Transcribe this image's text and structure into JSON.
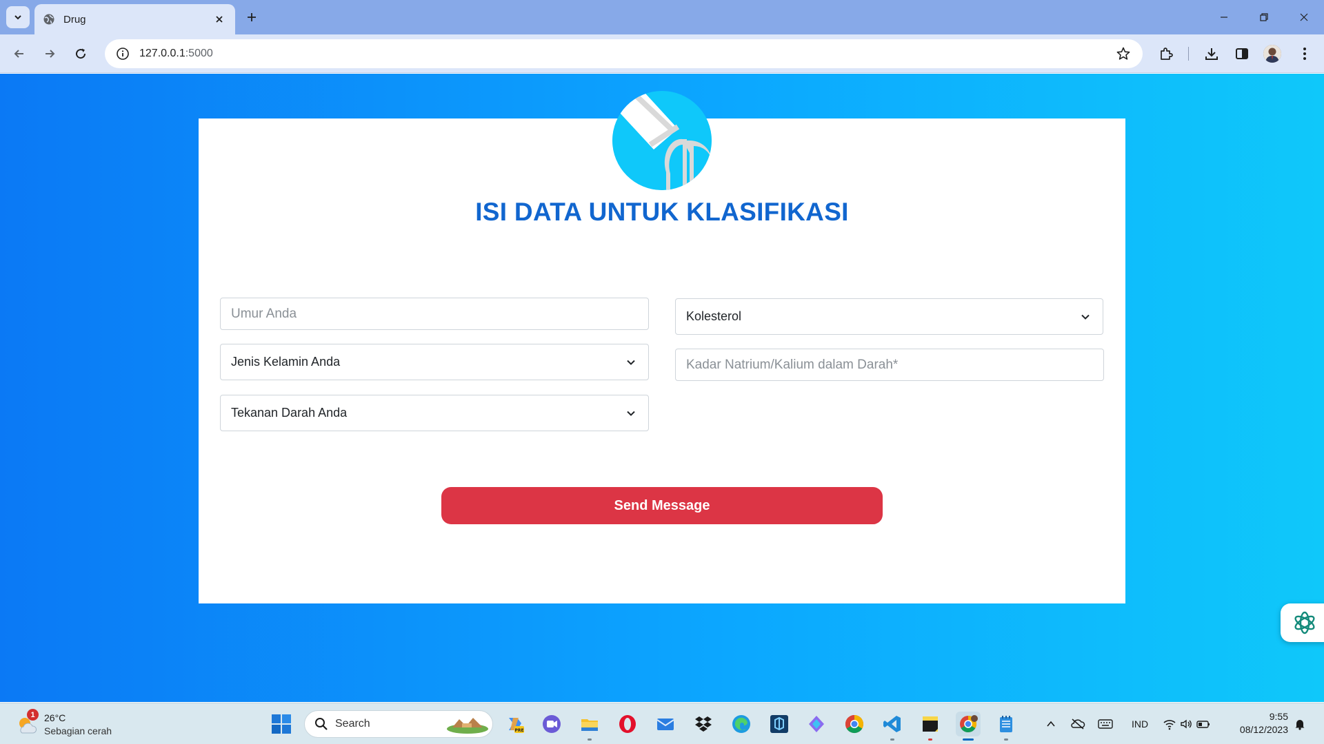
{
  "browser": {
    "tab_title": "Drug",
    "url_host": "127.0.0.1",
    "url_port": ":5000"
  },
  "form": {
    "title": "ISI DATA UNTUK KLASIFIKASI",
    "age_placeholder": "Umur Anda",
    "gender_select": "Jenis Kelamin Anda",
    "bp_select": "Tekanan Darah Anda",
    "cholesterol_select": "Kolesterol",
    "na_k_placeholder": "Kadar Natrium/Kalium dalam Darah*",
    "submit_label": "Send Message"
  },
  "taskbar": {
    "weather_badge": "1",
    "temperature": "26°C",
    "weather_desc": "Sebagian cerah",
    "search_label": "Search",
    "language": "IND",
    "time": "9:55",
    "date": "08/12/2023"
  },
  "colors": {
    "page_gradient_start": "#0b79f5",
    "page_gradient_end": "#0fc8fa",
    "title": "#1166cf",
    "submit_button": "#dc3545",
    "logo": "#0fc8fa"
  }
}
